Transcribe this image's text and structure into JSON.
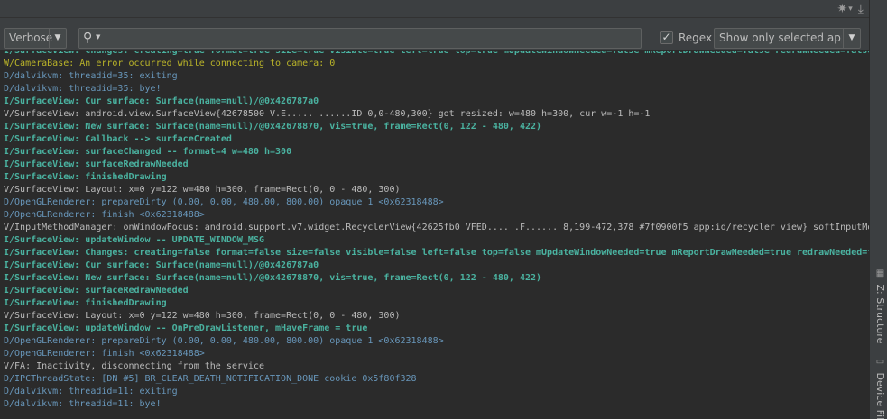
{
  "toolbar": {
    "verbose": {
      "label": "Verbose"
    },
    "search": {
      "value": "",
      "placeholder": ""
    },
    "regex": {
      "label": "Regex",
      "checked": true
    },
    "filter": {
      "label": "Show only selected applica"
    }
  },
  "right_tabs": {
    "structure": "Z: Structure",
    "device_file": "Device File"
  },
  "log": {
    "lines": [
      {
        "level": "I",
        "text": "I/SurfaceView: Changes: creating=true format=true size=true visible=true left=true top=true mUpdateWindowNeeded=false mReportDrawNeeded=false redrawNeeded=false"
      },
      {
        "level": "W",
        "text": "W/CameraBase: An error occurred while connecting to camera: 0"
      },
      {
        "level": "D",
        "text": "D/dalvikvm: threadid=35: exiting"
      },
      {
        "level": "D",
        "text": "D/dalvikvm: threadid=35: bye!"
      },
      {
        "level": "I",
        "text": "I/SurfaceView: Cur surface: Surface(name=null)/@0x426787a0"
      },
      {
        "level": "V",
        "text": "V/SurfaceView: android.view.SurfaceView{42678500 V.E..... ......ID 0,0-480,300} got resized: w=480 h=300, cur w=-1 h=-1"
      },
      {
        "level": "I",
        "text": "I/SurfaceView: New surface: Surface(name=null)/@0x42678870, vis=true, frame=Rect(0, 122 - 480, 422)"
      },
      {
        "level": "I",
        "text": "I/SurfaceView: Callback --> surfaceCreated"
      },
      {
        "level": "I",
        "text": "I/SurfaceView: surfaceChanged -- format=4 w=480 h=300"
      },
      {
        "level": "I",
        "text": "I/SurfaceView: surfaceRedrawNeeded"
      },
      {
        "level": "I",
        "text": "I/SurfaceView: finishedDrawing"
      },
      {
        "level": "V",
        "text": "V/SurfaceView: Layout: x=0 y=122 w=480 h=300, frame=Rect(0, 0 - 480, 300)"
      },
      {
        "level": "D",
        "text": "D/OpenGLRenderer: prepareDirty (0.00, 0.00, 480.00, 800.00) opaque 1 <0x62318488>"
      },
      {
        "level": "D",
        "text": "D/OpenGLRenderer: finish <0x62318488>"
      },
      {
        "level": "V",
        "text": "V/InputMethodManager: onWindowFocus: android.support.v7.widget.RecyclerView{42625fb0 VFED.... .F...... 8,199-472,378 #7f0900f5 app:id/recycler_view} softInputMo"
      },
      {
        "level": "I",
        "text": "I/SurfaceView: updateWindow -- UPDATE_WINDOW_MSG"
      },
      {
        "level": "I",
        "text": "I/SurfaceView: Changes: creating=false format=false size=false visible=false left=false top=false mUpdateWindowNeeded=true mReportDrawNeeded=true redrawNeeded=f"
      },
      {
        "level": "I",
        "text": "I/SurfaceView: Cur surface: Surface(name=null)/@0x426787a0"
      },
      {
        "level": "I",
        "text": "I/SurfaceView: New surface: Surface(name=null)/@0x42678870, vis=true, frame=Rect(0, 122 - 480, 422)"
      },
      {
        "level": "I",
        "text": "I/SurfaceView: surfaceRedrawNeeded"
      },
      {
        "level": "I",
        "text": "I/SurfaceView: finishedDrawing"
      },
      {
        "level": "V",
        "text": "V/SurfaceView: Layout: x=0 y=122 w=480 h=300, frame=Rect(0, 0 - 480, 300)"
      },
      {
        "level": "I",
        "text": "I/SurfaceView: updateWindow -- OnPreDrawListener, mHaveFrame = true"
      },
      {
        "level": "D",
        "text": "D/OpenGLRenderer: prepareDirty (0.00, 0.00, 480.00, 800.00) opaque 1 <0x62318488>"
      },
      {
        "level": "D",
        "text": "D/OpenGLRenderer: finish <0x62318488>"
      },
      {
        "level": "V",
        "text": "V/FA: Inactivity, disconnecting from the service"
      },
      {
        "level": "D",
        "text": "D/IPCThreadState: [DN #5] BR_CLEAR_DEATH_NOTIFICATION_DONE cookie 0x5f80f328"
      },
      {
        "level": "D",
        "text": "D/dalvikvm: threadid=11: exiting"
      },
      {
        "level": "D",
        "text": "D/dalvikvm: threadid=11: bye!"
      }
    ]
  }
}
